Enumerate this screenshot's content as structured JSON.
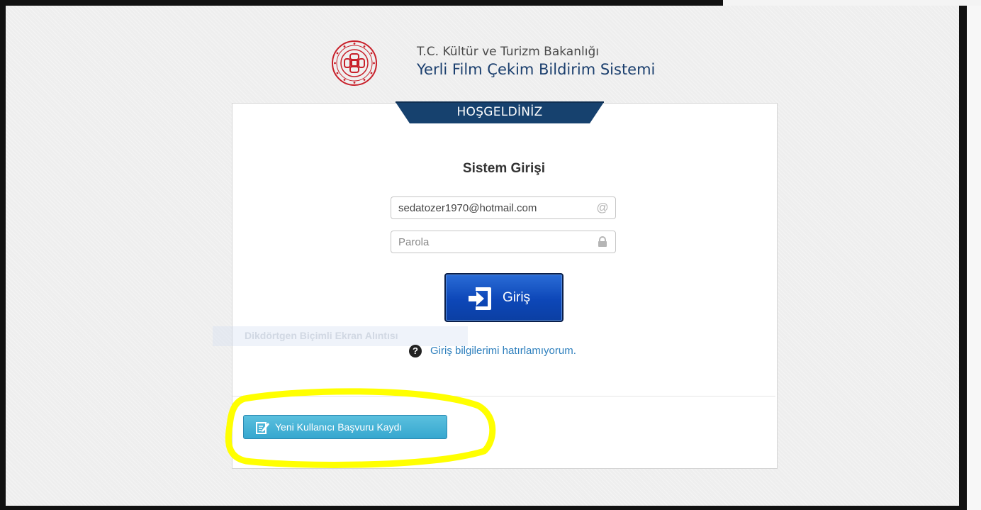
{
  "header": {
    "ministry": "T.C. Kültür ve Turizm Bakanlığı",
    "system_name": "Yerli Film Çekim Bildirim Sistemi",
    "logo_icon": "ministry-seal-icon"
  },
  "tab": {
    "label": "HOŞGELDİNİZ"
  },
  "login": {
    "title": "Sistem Girişi",
    "email_value": "sedatozer1970@hotmail.com",
    "email_icon": "@",
    "password_placeholder": "Parola",
    "password_icon": "lock-icon",
    "submit_label": "Giriş",
    "submit_icon": "sign-in-icon",
    "forgot_icon": "question-icon",
    "forgot_label": "Giriş bilgilerimi hatırlamıyorum."
  },
  "overlay": {
    "ghost_text": "Dikdörtgen Biçimli Ekran Alıntısı"
  },
  "register": {
    "label": "Yeni Kullanıcı Başvuru Kaydı",
    "icon": "edit-icon"
  },
  "colors": {
    "brand_navy": "#1b3f6e",
    "login_button": "#0d47b8",
    "register_button": "#46b4d8",
    "link": "#2d7fbd",
    "highlight": "#ffff00"
  }
}
